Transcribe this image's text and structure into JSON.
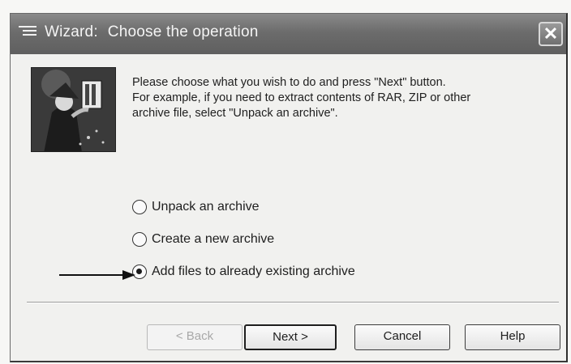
{
  "window": {
    "title_app": "Wizard:",
    "title_step": "Choose the operation",
    "close_glyph": "✕",
    "title_icon": "list-icon"
  },
  "intro": {
    "line1": "Please choose what you wish to do and press \"Next\" button.",
    "line2": "For example, if you need to extract contents of RAR, ZIP or other",
    "line3": "archive file, select \"Unpack an archive\"."
  },
  "logo": {
    "icon": "wizard-logo-icon"
  },
  "options": [
    {
      "label": "Unpack an archive",
      "selected": false
    },
    {
      "label": "Create a new archive",
      "selected": false
    },
    {
      "label": "Add files to already existing archive",
      "selected": true
    }
  ],
  "annotation": {
    "icon": "arrow-right-icon"
  },
  "buttons": {
    "back": "< Back",
    "next": "Next >",
    "cancel": "Cancel",
    "help": "Help"
  },
  "colors": {
    "titlebar": "#6c6c6c",
    "dialog_bg": "#f1f1ef"
  }
}
